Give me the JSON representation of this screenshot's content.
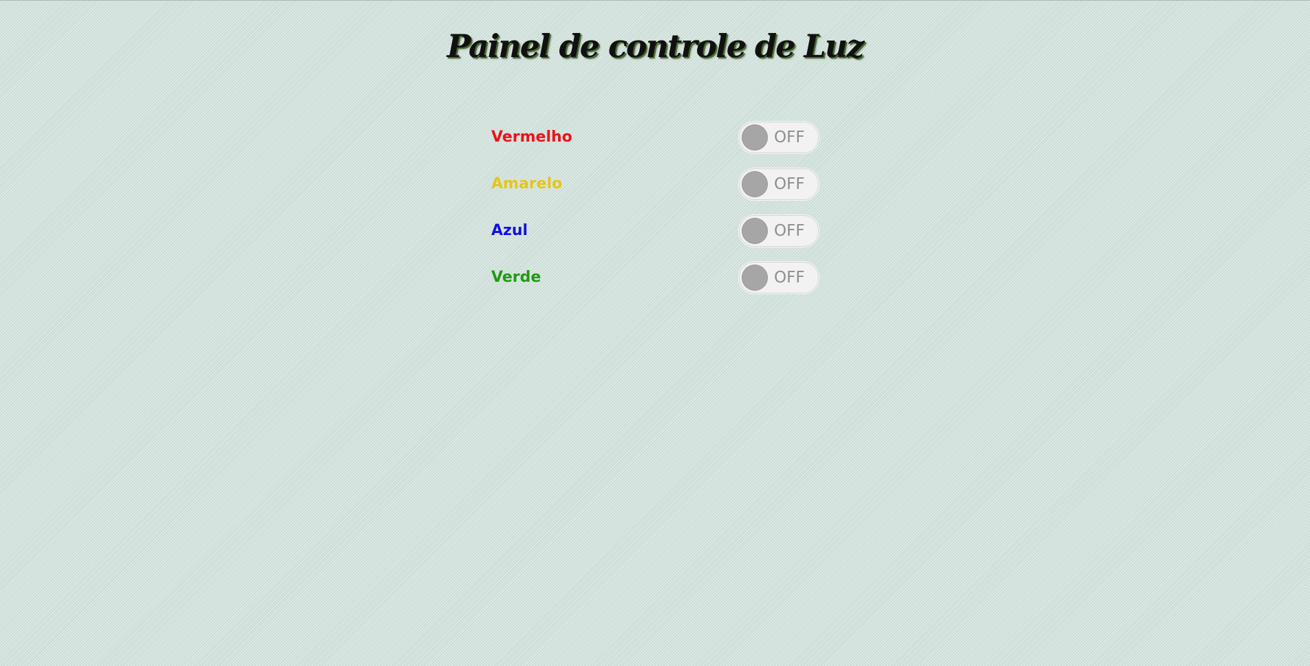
{
  "page": {
    "title": "Painel de controle de Luz"
  },
  "lights": [
    {
      "label": "Vermelho",
      "color": "#e8141a",
      "state_label": "OFF",
      "on": false
    },
    {
      "label": "Amarelo",
      "color": "#e3c51a",
      "state_label": "OFF",
      "on": false
    },
    {
      "label": "Azul",
      "color": "#1212e0",
      "state_label": "OFF",
      "on": false
    },
    {
      "label": "Verde",
      "color": "#1f9a12",
      "state_label": "OFF",
      "on": false
    }
  ],
  "colors": {
    "background": "#d7e5e0",
    "title_text": "#111111",
    "title_shadow": "#4b6b2c",
    "toggle_track": "#f2f2f2",
    "toggle_knob": "#a6a6a6",
    "toggle_text": "#8e8e8e"
  }
}
